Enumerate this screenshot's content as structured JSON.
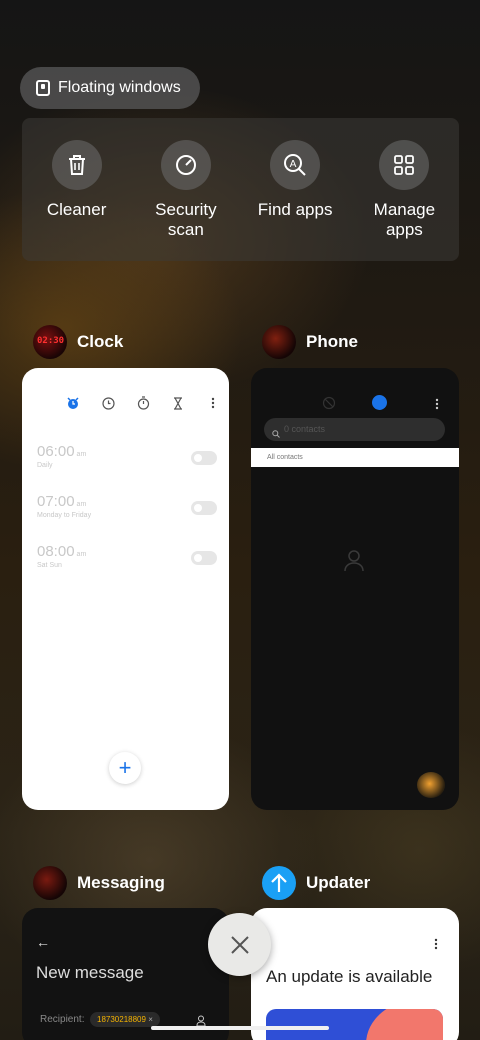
{
  "floating": {
    "label": "Floating windows",
    "icon": "floating-window-icon"
  },
  "tools": [
    {
      "label": "Cleaner",
      "icon": "trash-icon"
    },
    {
      "label": "Security scan",
      "icon": "security-icon"
    },
    {
      "label": "Find apps",
      "icon": "find-apps-icon"
    },
    {
      "label": "Manage apps",
      "icon": "grid-icon"
    }
  ],
  "clock": {
    "title": "Clock",
    "icon_text": "02:30",
    "alarms": [
      {
        "time": "06:00",
        "ampm": "am",
        "repeat": "Daily"
      },
      {
        "time": "07:00",
        "ampm": "am",
        "repeat": "Monday to Friday"
      },
      {
        "time": "08:00",
        "ampm": "am",
        "repeat": "Sat Sun"
      }
    ],
    "fab_label": "+"
  },
  "phone": {
    "title": "Phone",
    "search_placeholder": "0 contacts",
    "section": "All contacts"
  },
  "messaging": {
    "title": "Messaging",
    "heading": "New message",
    "recipient_label": "Recipient:",
    "recipient_chip": "18730218809"
  },
  "updater": {
    "title": "Updater",
    "heading": "An update is available"
  },
  "colors": {
    "accent": "#1a73e8",
    "updater_blue": "#1aa0f5"
  }
}
